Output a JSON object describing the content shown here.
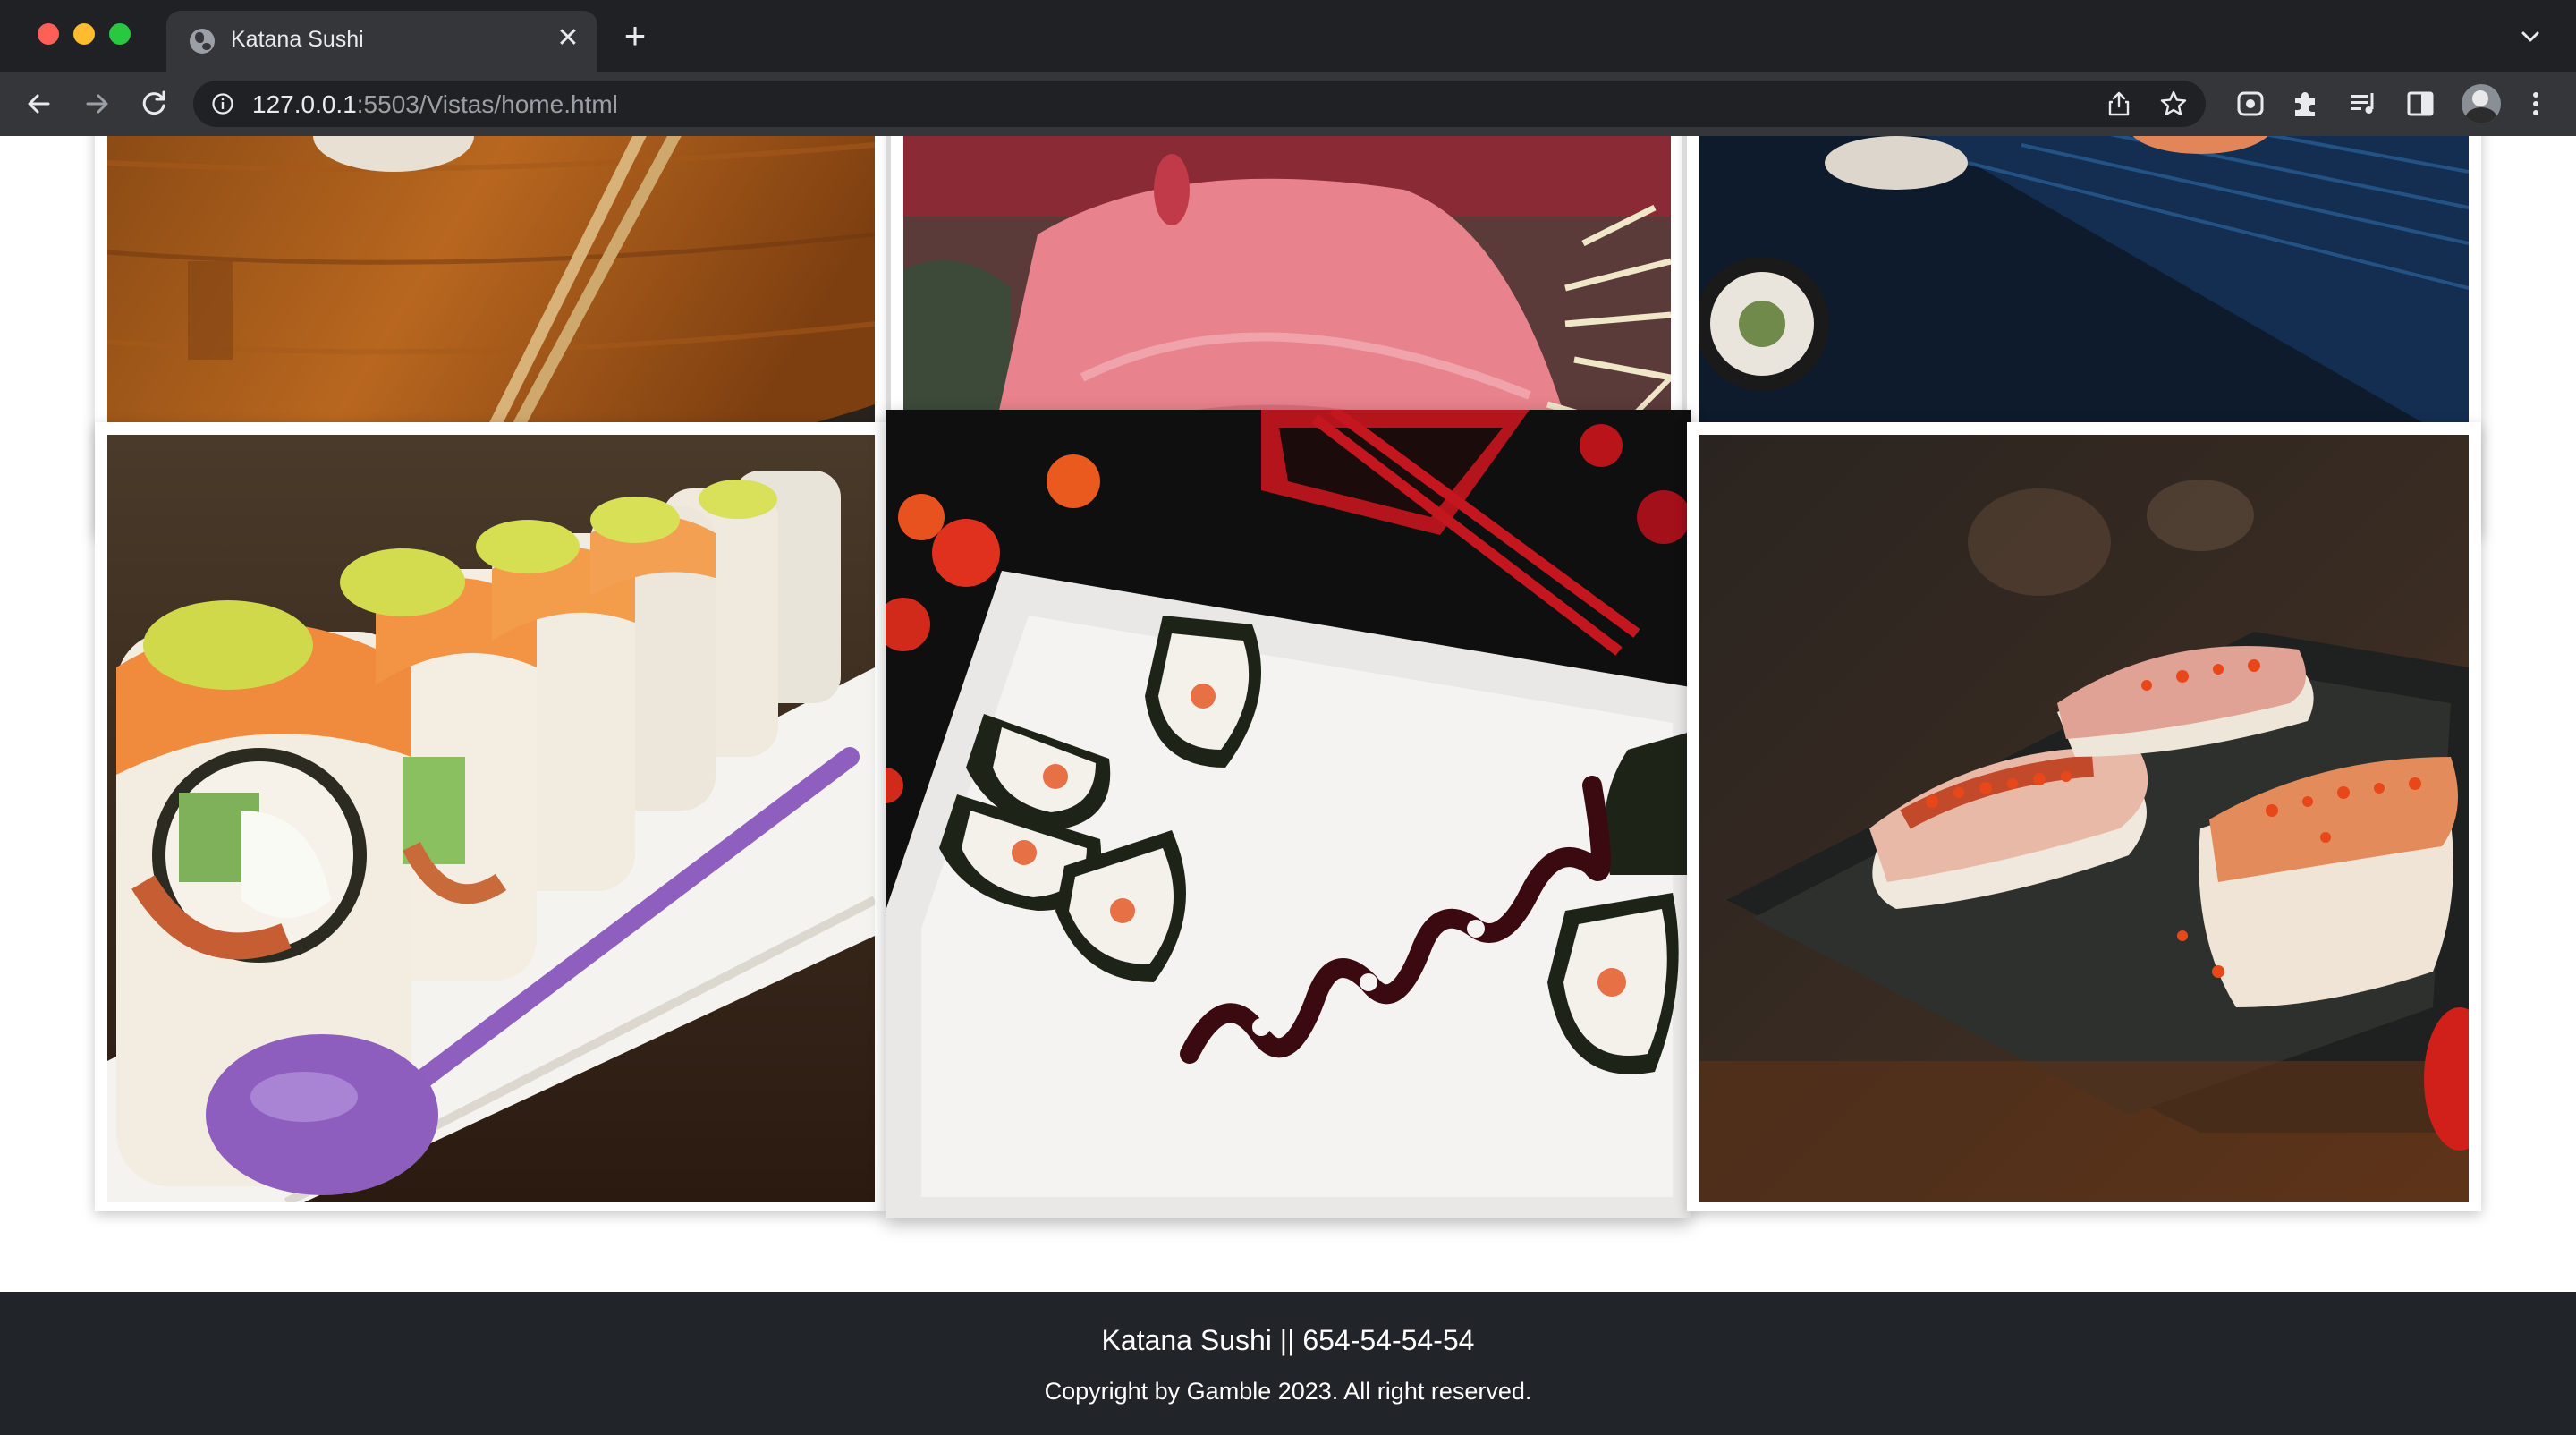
{
  "browser": {
    "tab_title": "Katana Sushi",
    "url_host": "127.0.0.1",
    "url_rest": ":5503/Vistas/home.html"
  },
  "gallery": {
    "images": [
      {
        "name": "Sushi roll on bamboo board with chopsticks"
      },
      {
        "name": "Tuna sashimi slice"
      },
      {
        "name": "Maki rolls on dark plate with chopsticks"
      },
      {
        "name": "Salmon avocado roll with purple sauce spoon"
      },
      {
        "name": "Maki on white plate with sauce swirl and red chopsticks"
      },
      {
        "name": "Torched nigiri with tobiko on dark tray"
      }
    ]
  },
  "footer": {
    "title": "Katana Sushi || 654-54-54-54",
    "copyright": "Copyright by Gamble 2023. All right reserved."
  },
  "colors": {
    "chrome_bg": "#202124",
    "toolbar_bg": "#35363a",
    "footer_bg": "#212529"
  }
}
